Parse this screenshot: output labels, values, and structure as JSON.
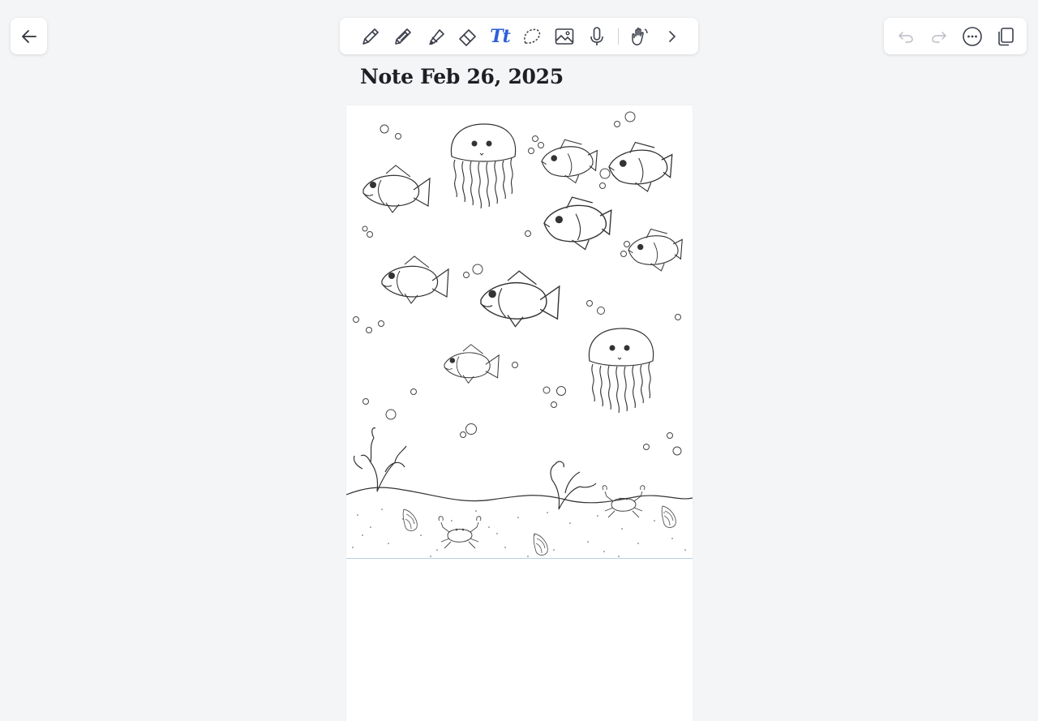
{
  "note": {
    "title": "Note Feb 26, 2025"
  },
  "toolbar": {
    "tools": [
      "pen-icon",
      "pencil-icon",
      "highlighter-icon",
      "eraser-icon",
      "text-icon",
      "lasso-icon",
      "image-icon",
      "microphone-icon",
      "hand-icon",
      "chevron-right-icon"
    ],
    "text_tool_label": "Tt",
    "accent_color": "#2f5fd8"
  },
  "top_right": {
    "tools": [
      "undo-icon",
      "redo-icon",
      "more-icon",
      "pages-icon"
    ]
  },
  "colors": {
    "background": "#f4f5f7",
    "page": "#ffffff",
    "ink": "#2b2b2b",
    "icon": "#3a3f4a",
    "disabled": "#b8bcc4"
  }
}
